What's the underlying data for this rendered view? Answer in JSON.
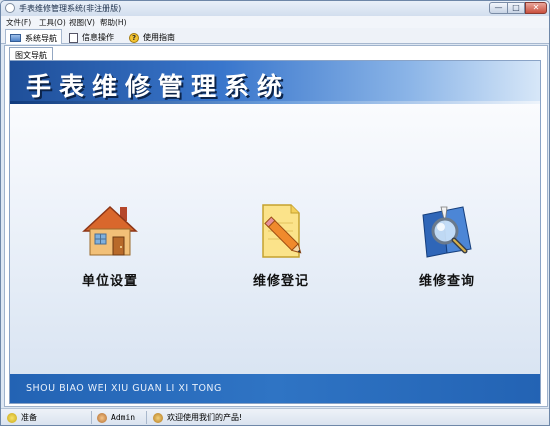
{
  "window": {
    "title": "手表维修管理系统(非注册版)",
    "controls": {
      "minimize": "—",
      "maximize": "□",
      "close": "✕"
    }
  },
  "menu": [
    {
      "label": "文件(F)"
    },
    {
      "label": "工具(O)"
    },
    {
      "label": "视图(V)"
    },
    {
      "label": "帮助(H)"
    }
  ],
  "tabs": [
    {
      "label": "系统导航",
      "icon": "monitor-icon",
      "active": true
    },
    {
      "label": "信息操作",
      "icon": "document-icon",
      "active": false
    },
    {
      "label": "使用指南",
      "icon": "help-icon",
      "active": false
    }
  ],
  "subtab": {
    "label": "图文导航"
  },
  "banner": {
    "title": "手表维修管理系统"
  },
  "features": [
    {
      "label": "单位设置",
      "icon": "house-icon"
    },
    {
      "label": "维修登记",
      "icon": "notepad-pencil-icon"
    },
    {
      "label": "维修查询",
      "icon": "magnifier-book-icon"
    }
  ],
  "footer": {
    "pinyin": "SHOU BIAO WEI XIU GUAN LI XI TONG"
  },
  "status": {
    "ready": "准备",
    "user": "Admin",
    "welcome": "欢迎使用我们的产品!"
  },
  "colors": {
    "banner": "#2f6fc4",
    "footer_band": "#2a6cbd",
    "accent": "#f4c431"
  }
}
